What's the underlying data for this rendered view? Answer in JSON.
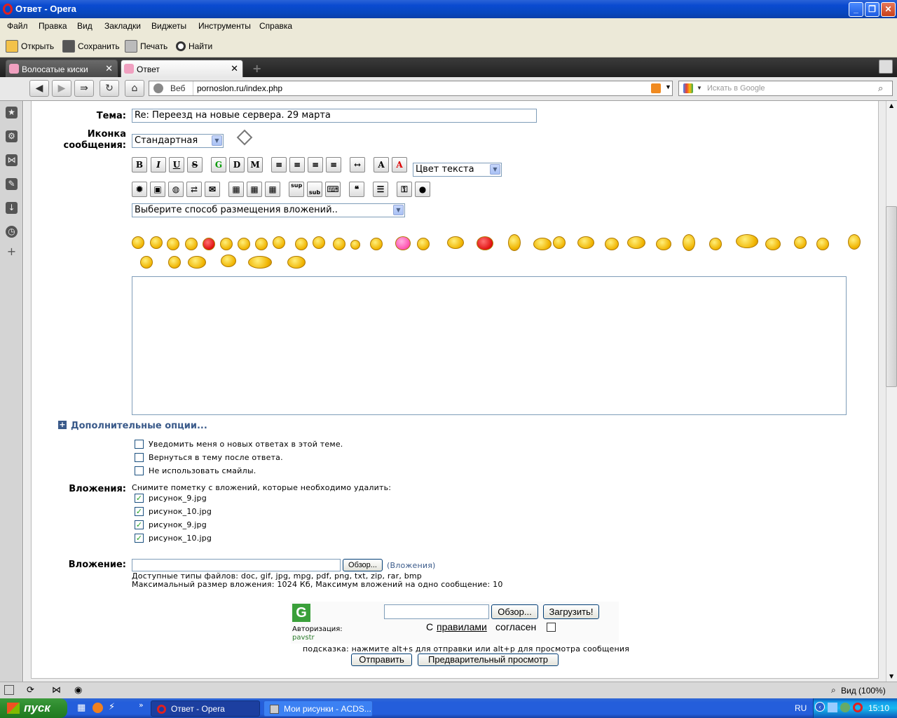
{
  "window": {
    "title": "Ответ - Opera"
  },
  "menu": [
    "Файл",
    "Правка",
    "Вид",
    "Закладки",
    "Виджеты",
    "Инструменты",
    "Справка"
  ],
  "toolbar": {
    "open": "Открыть",
    "save": "Сохранить",
    "print": "Печать",
    "find": "Найти"
  },
  "tabs": [
    {
      "label": "Волосатые киски",
      "active": false
    },
    {
      "label": "Ответ",
      "active": true
    }
  ],
  "address": {
    "web_label": "Веб",
    "url": "pornoslon.ru/index.php",
    "search_placeholder": "Искать в Google"
  },
  "form": {
    "subject_label": "Тема:",
    "subject_value": "Re: Переезд на новые сервера. 29 марта",
    "icon_label": "Иконка сообщения:",
    "icon_value": "Стандартная",
    "text_color_value": "Цвет текста",
    "attach_mode_value": "Выберите способ размещения вложений..",
    "format_buttons_row1": [
      "B",
      "I",
      "U",
      "S",
      "G",
      "D",
      "M",
      "≡",
      "≡",
      "≡",
      "≡",
      "↔",
      "A",
      "A"
    ],
    "format_buttons_row2": [
      "sup",
      "sub"
    ],
    "extra_options_label": "Дополнительные опции...",
    "options": [
      {
        "label": "Уведомить меня о новых ответах в этой теме.",
        "checked": false
      },
      {
        "label": "Вернуться в тему после ответа.",
        "checked": false
      },
      {
        "label": "Не использовать смайлы.",
        "checked": false
      }
    ],
    "attachments_label": "Вложения:",
    "attachments_hint": "Снимите пометку с вложений, которые необходимо удалить:",
    "attachments": [
      {
        "name": "рисунок_9.jpg",
        "checked": true
      },
      {
        "name": "рисунок_10.jpg",
        "checked": true
      },
      {
        "name": "рисунок_9.jpg",
        "checked": true
      },
      {
        "name": "рисунок_10.jpg",
        "checked": true
      }
    ],
    "attachment_label": "Вложение:",
    "browse_label": "Обзор...",
    "attachments_link": "(Вложения)",
    "allowed_types": "Доступные типы файлов: doc, gif, jpg, mpg, pdf, png, txt, zip, rar, bmp",
    "max_size": "Максимальный размер вложения: 1024 Кб, Максимум вложений на одно сообщение: 10",
    "hint": "подсказка: нажмите alt+s для отправки или alt+p для просмотра сообщения",
    "submit_label": "Отправить",
    "preview_label": "Предварительный просмотр"
  },
  "uploader": {
    "logo": "G",
    "auth_label": "Авторизация:",
    "user": "pavstr",
    "browse_label": "Обзор...",
    "upload_label": "Загрузить!",
    "agree_prefix": "С",
    "agree_link": "правилами",
    "agree_suffix": "согласен"
  },
  "statusbar": {
    "zoom": "Вид (100%)"
  },
  "taskbar": {
    "start": "пуск",
    "tasks": [
      "Ответ - Opera",
      "Мои рисунки - ACDS..."
    ],
    "lang": "RU",
    "time": "15:10"
  },
  "colors": {
    "accent_blue": "#0a4ad0",
    "link_blue": "#3a5a8a",
    "check_green": "#21a121"
  }
}
